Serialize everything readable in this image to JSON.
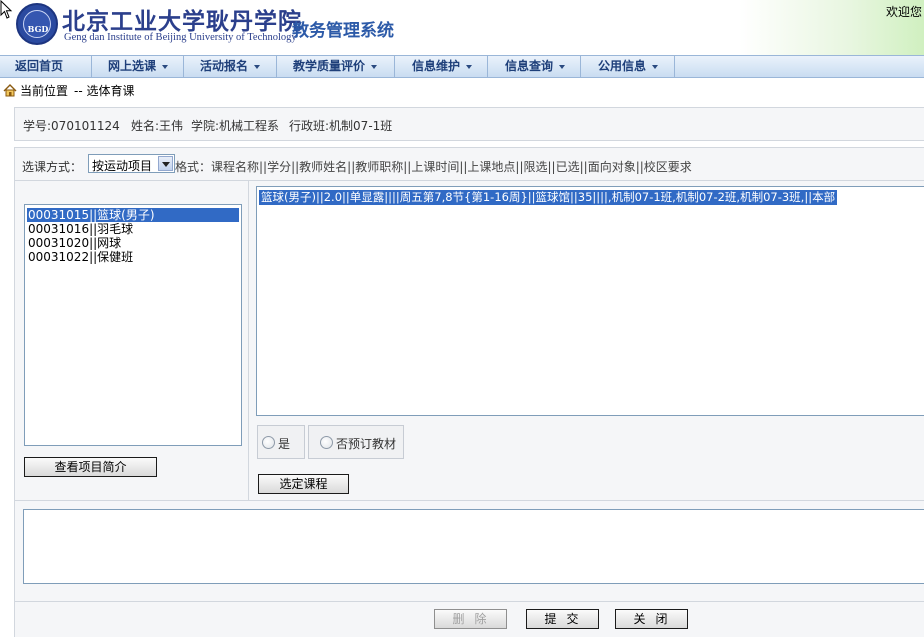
{
  "header": {
    "logo_seal_text": "BGD",
    "logo_cn": "北京工业大学耿丹学院",
    "logo_en": "Geng dan Institute of Beijing University of Technology",
    "system_title": "教务管理系统",
    "welcome": "欢迎您"
  },
  "nav": {
    "items": [
      {
        "label": "返回首页",
        "dropdown": false
      },
      {
        "label": "网上选课",
        "dropdown": true
      },
      {
        "label": "活动报名",
        "dropdown": true
      },
      {
        "label": "教学质量评价",
        "dropdown": true
      },
      {
        "label": "信息维护",
        "dropdown": true
      },
      {
        "label": "信息查询",
        "dropdown": true
      },
      {
        "label": "公用信息",
        "dropdown": true
      }
    ]
  },
  "breadcrumb": {
    "label": "当前位置",
    "path": "-- 选体育课"
  },
  "student": {
    "id_text": "学号:070101124",
    "name_text": "姓名:王伟",
    "college_text": "学院:机械工程系",
    "class_text": "行政班:机制07-1班"
  },
  "selection": {
    "mode_label": "选课方式：",
    "mode_value": "按运动项目",
    "format_text": "格式：课程名称||学分||教师姓名||教师职称||上课时间||上课地点||限选||已选||面向对象||校区要求"
  },
  "project_list": {
    "items": [
      {
        "text": "00031015||篮球(男子)",
        "selected": true
      },
      {
        "text": "00031016||羽毛球",
        "selected": false
      },
      {
        "text": "00031020||网球",
        "selected": false
      },
      {
        "text": "00031022||保健班",
        "selected": false
      }
    ],
    "intro_button": "查看项目简介"
  },
  "course_list": {
    "items": [
      {
        "text": "篮球(男子)||2.0||单显露||||周五第7,8节{第1-16周}||篮球馆||35||||,机制07-1班,机制07-2班,机制07-3班,||本部",
        "selected": true
      }
    ]
  },
  "textbook": {
    "yes_label": "是",
    "no_label": "否预订教材"
  },
  "select_course_button": "选定课程",
  "bottom_buttons": {
    "delete": "删除",
    "submit": "提交",
    "close": "关闭"
  },
  "colors": {
    "selection_bg": "#316ac5",
    "title_blue": "#2c5aa8",
    "nav_text": "#1e3f7a",
    "panel_bg": "#f5f6f8"
  }
}
